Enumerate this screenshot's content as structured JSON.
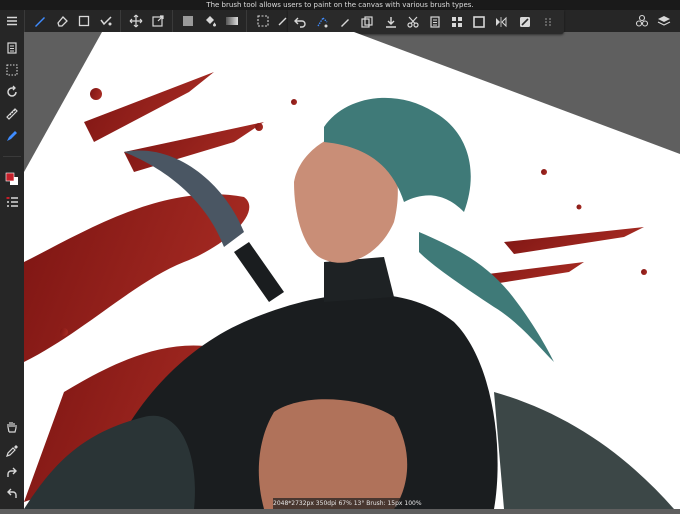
{
  "hint_text": "The brush tool allows users to paint on the canvas with various brush types.",
  "status_text": "2048*2732px 350dpi 67% 13° Brush: 15px 100%",
  "colors": {
    "accent": "#3f8cff",
    "toolbar_bg": "#262626",
    "hint_bg": "#1a1a1a",
    "icon": "#d8d8d8",
    "main_color": "#c4202a",
    "sub_color": "#ffffff"
  },
  "toolbar": {
    "tools": [
      {
        "icon": "brush-icon",
        "active": true
      },
      {
        "icon": "eraser-icon"
      },
      {
        "icon": "square-outline-icon"
      },
      {
        "icon": "smudge-icon"
      },
      {
        "icon": "move-icon"
      },
      {
        "icon": "transform-icon"
      },
      {
        "icon": "fill-color-icon"
      },
      {
        "icon": "bucket-icon"
      },
      {
        "icon": "gradient-icon"
      },
      {
        "icon": "selection-rect-icon"
      }
    ],
    "right": [
      {
        "icon": "materials-icon"
      },
      {
        "icon": "layers-icon"
      }
    ]
  },
  "selection_tools": [
    {
      "icon": "undo-selection-icon"
    },
    {
      "icon": "lasso-icon"
    },
    {
      "icon": "pen-icon"
    },
    {
      "icon": "copy-icon"
    },
    {
      "icon": "import-icon"
    },
    {
      "icon": "cut-icon"
    },
    {
      "icon": "paste-icon"
    },
    {
      "icon": "grid-icon"
    },
    {
      "icon": "frame-icon"
    },
    {
      "icon": "flip-icon"
    },
    {
      "icon": "fill-selection-icon"
    },
    {
      "icon": "drag-handle-icon"
    }
  ],
  "sidebar": {
    "top": [
      {
        "icon": "menu-icon"
      },
      {
        "icon": "pages-icon"
      },
      {
        "icon": "select-dotted-icon"
      },
      {
        "icon": "rotate-icon"
      },
      {
        "icon": "ruler-icon"
      },
      {
        "icon": "pen-tool-icon",
        "active": true
      },
      {
        "icon": "color-swatch-icon"
      },
      {
        "icon": "list-icon"
      }
    ],
    "bottom": [
      {
        "icon": "hand-icon"
      },
      {
        "icon": "eyedropper-icon"
      },
      {
        "icon": "redo-icon"
      },
      {
        "icon": "undo-icon"
      }
    ]
  }
}
